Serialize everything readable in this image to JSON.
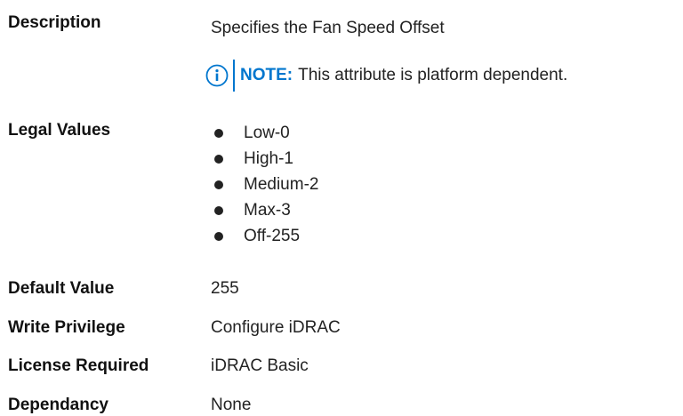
{
  "rows": {
    "description": {
      "label": "Description",
      "value": "Specifies the Fan Speed Offset"
    },
    "note": {
      "icon": "info-icon",
      "heading": "NOTE:",
      "text": "This attribute is platform dependent."
    },
    "legal_values": {
      "label": "Legal Values",
      "items": [
        "Low-0",
        "High-1",
        "Medium-2",
        "Max-3",
        "Off-255"
      ]
    },
    "default_value": {
      "label": "Default Value",
      "value": "255"
    },
    "write_privilege": {
      "label": "Write Privilege",
      "value": "Configure iDRAC"
    },
    "license_required": {
      "label": "License Required",
      "value": "iDRAC Basic"
    },
    "dependancy": {
      "label": "Dependancy",
      "value": "None"
    }
  },
  "colors": {
    "accent": "#0076ce",
    "text": "#222222",
    "label": "#111111"
  }
}
